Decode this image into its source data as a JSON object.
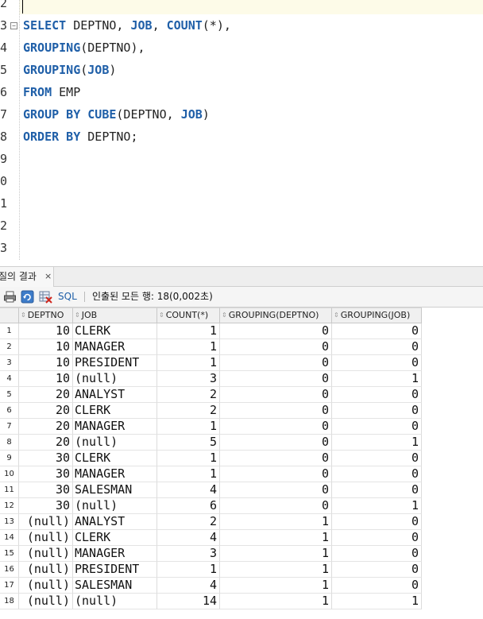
{
  "editor": {
    "lines": [
      {
        "num": "2",
        "fold": false,
        "tokens": []
      },
      {
        "num": "3",
        "fold": true,
        "tokens": [
          {
            "t": "SELECT",
            "kw": true
          },
          {
            "t": " DEPTNO, ",
            "kw": false
          },
          {
            "t": "JOB",
            "kw": true
          },
          {
            "t": ", ",
            "kw": false
          },
          {
            "t": "COUNT",
            "kw": true
          },
          {
            "t": "(*),",
            "kw": false
          }
        ]
      },
      {
        "num": "4",
        "fold": false,
        "tokens": [
          {
            "t": "GROUPING",
            "kw": true
          },
          {
            "t": "(DEPTNO),",
            "kw": false
          }
        ]
      },
      {
        "num": "5",
        "fold": false,
        "tokens": [
          {
            "t": "GROUPING",
            "kw": true
          },
          {
            "t": "(",
            "kw": false
          },
          {
            "t": "JOB",
            "kw": true
          },
          {
            "t": ")",
            "kw": false
          }
        ]
      },
      {
        "num": "6",
        "fold": false,
        "tokens": [
          {
            "t": "FROM",
            "kw": true
          },
          {
            "t": " EMP",
            "kw": false
          }
        ]
      },
      {
        "num": "7",
        "fold": false,
        "tokens": [
          {
            "t": "GROUP BY",
            "kw": true
          },
          {
            "t": " ",
            "kw": false
          },
          {
            "t": "CUBE",
            "kw": true
          },
          {
            "t": "(DEPTNO, ",
            "kw": false
          },
          {
            "t": "JOB",
            "kw": true
          },
          {
            "t": ")",
            "kw": false
          }
        ]
      },
      {
        "num": "8",
        "fold": false,
        "tokens": [
          {
            "t": "ORDER BY",
            "kw": true
          },
          {
            "t": " DEPTNO;",
            "kw": false
          }
        ]
      },
      {
        "num": "9",
        "fold": false,
        "tokens": []
      },
      {
        "num": "0",
        "fold": false,
        "tokens": []
      },
      {
        "num": "1",
        "fold": false,
        "tokens": []
      },
      {
        "num": "2",
        "fold": false,
        "tokens": []
      },
      {
        "num": "3",
        "fold": false,
        "tokens": []
      }
    ]
  },
  "results": {
    "tab_label": "질의 결과",
    "tab_close": "×",
    "toolbar": {
      "sql_label": "SQL",
      "status": "인출된 모든 행: 18(0,002초)"
    },
    "columns": [
      "DEPTNO",
      "JOB",
      "COUNT(*)",
      "GROUPING(DEPTNO)",
      "GROUPING(JOB)"
    ],
    "rows": [
      [
        "1",
        "10",
        "CLERK",
        "1",
        "0",
        "0"
      ],
      [
        "2",
        "10",
        "MANAGER",
        "1",
        "0",
        "0"
      ],
      [
        "3",
        "10",
        "PRESIDENT",
        "1",
        "0",
        "0"
      ],
      [
        "4",
        "10",
        "(null)",
        "3",
        "0",
        "1"
      ],
      [
        "5",
        "20",
        "ANALYST",
        "2",
        "0",
        "0"
      ],
      [
        "6",
        "20",
        "CLERK",
        "2",
        "0",
        "0"
      ],
      [
        "7",
        "20",
        "MANAGER",
        "1",
        "0",
        "0"
      ],
      [
        "8",
        "20",
        "(null)",
        "5",
        "0",
        "1"
      ],
      [
        "9",
        "30",
        "CLERK",
        "1",
        "0",
        "0"
      ],
      [
        "10",
        "30",
        "MANAGER",
        "1",
        "0",
        "0"
      ],
      [
        "11",
        "30",
        "SALESMAN",
        "4",
        "0",
        "0"
      ],
      [
        "12",
        "30",
        "(null)",
        "6",
        "0",
        "1"
      ],
      [
        "13",
        "(null)",
        "ANALYST",
        "2",
        "1",
        "0"
      ],
      [
        "14",
        "(null)",
        "CLERK",
        "4",
        "1",
        "0"
      ],
      [
        "15",
        "(null)",
        "MANAGER",
        "3",
        "1",
        "0"
      ],
      [
        "16",
        "(null)",
        "PRESIDENT",
        "1",
        "1",
        "0"
      ],
      [
        "17",
        "(null)",
        "SALESMAN",
        "4",
        "1",
        "0"
      ],
      [
        "18",
        "(null)",
        "(null)",
        "14",
        "1",
        "1"
      ]
    ]
  },
  "icons": {
    "print": "printer-icon",
    "refresh": "refresh-icon",
    "export": "export-icon"
  },
  "colors": {
    "keyword": "#1f5fa8"
  }
}
